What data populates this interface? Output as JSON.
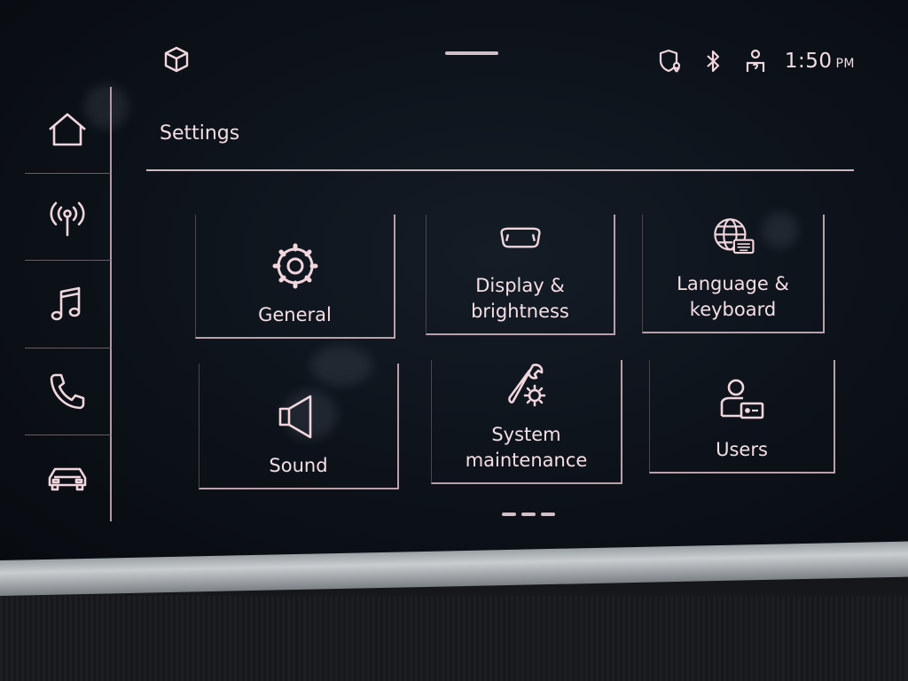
{
  "status_bar": {
    "time": "1:50",
    "period": "PM",
    "icons": [
      "cube-icon",
      "privacy-location-icon",
      "bluetooth-icon",
      "user-help-icon"
    ]
  },
  "sidebar": {
    "items": [
      {
        "name": "home",
        "icon": "home-icon"
      },
      {
        "name": "radio",
        "icon": "radio-antenna-icon"
      },
      {
        "name": "media",
        "icon": "music-note-icon"
      },
      {
        "name": "phone",
        "icon": "phone-icon"
      },
      {
        "name": "car",
        "icon": "car-icon"
      }
    ]
  },
  "header": {
    "title": "Settings"
  },
  "tiles": [
    {
      "label": "General",
      "icon": "gear-icon"
    },
    {
      "label": "Display &\nbrightness",
      "icon": "display-icon"
    },
    {
      "label": "Language &\nkeyboard",
      "icon": "globe-keyboard-icon"
    },
    {
      "label": "Sound",
      "icon": "speaker-icon"
    },
    {
      "label": "System\nmaintenance",
      "icon": "wrench-gear-icon"
    },
    {
      "label": "Users",
      "icon": "user-card-icon"
    }
  ],
  "pagination": {
    "pages": 3,
    "current": 1
  },
  "colors": {
    "accent": "#f1d6dd",
    "background": "#0c1118"
  }
}
